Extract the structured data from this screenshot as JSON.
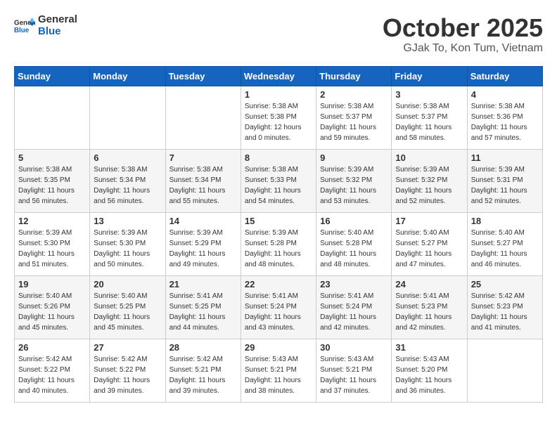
{
  "header": {
    "logo_general": "General",
    "logo_blue": "Blue",
    "month_title": "October 2025",
    "location": "GJak To, Kon Tum, Vietnam"
  },
  "days_of_week": [
    "Sunday",
    "Monday",
    "Tuesday",
    "Wednesday",
    "Thursday",
    "Friday",
    "Saturday"
  ],
  "weeks": [
    [
      null,
      null,
      null,
      {
        "day": "1",
        "sunrise": "Sunrise: 5:38 AM",
        "sunset": "Sunset: 5:38 PM",
        "daylight": "Daylight: 12 hours and 0 minutes."
      },
      {
        "day": "2",
        "sunrise": "Sunrise: 5:38 AM",
        "sunset": "Sunset: 5:37 PM",
        "daylight": "Daylight: 11 hours and 59 minutes."
      },
      {
        "day": "3",
        "sunrise": "Sunrise: 5:38 AM",
        "sunset": "Sunset: 5:37 PM",
        "daylight": "Daylight: 11 hours and 58 minutes."
      },
      {
        "day": "4",
        "sunrise": "Sunrise: 5:38 AM",
        "sunset": "Sunset: 5:36 PM",
        "daylight": "Daylight: 11 hours and 57 minutes."
      }
    ],
    [
      {
        "day": "5",
        "sunrise": "Sunrise: 5:38 AM",
        "sunset": "Sunset: 5:35 PM",
        "daylight": "Daylight: 11 hours and 56 minutes."
      },
      {
        "day": "6",
        "sunrise": "Sunrise: 5:38 AM",
        "sunset": "Sunset: 5:34 PM",
        "daylight": "Daylight: 11 hours and 56 minutes."
      },
      {
        "day": "7",
        "sunrise": "Sunrise: 5:38 AM",
        "sunset": "Sunset: 5:34 PM",
        "daylight": "Daylight: 11 hours and 55 minutes."
      },
      {
        "day": "8",
        "sunrise": "Sunrise: 5:38 AM",
        "sunset": "Sunset: 5:33 PM",
        "daylight": "Daylight: 11 hours and 54 minutes."
      },
      {
        "day": "9",
        "sunrise": "Sunrise: 5:39 AM",
        "sunset": "Sunset: 5:32 PM",
        "daylight": "Daylight: 11 hours and 53 minutes."
      },
      {
        "day": "10",
        "sunrise": "Sunrise: 5:39 AM",
        "sunset": "Sunset: 5:32 PM",
        "daylight": "Daylight: 11 hours and 52 minutes."
      },
      {
        "day": "11",
        "sunrise": "Sunrise: 5:39 AM",
        "sunset": "Sunset: 5:31 PM",
        "daylight": "Daylight: 11 hours and 52 minutes."
      }
    ],
    [
      {
        "day": "12",
        "sunrise": "Sunrise: 5:39 AM",
        "sunset": "Sunset: 5:30 PM",
        "daylight": "Daylight: 11 hours and 51 minutes."
      },
      {
        "day": "13",
        "sunrise": "Sunrise: 5:39 AM",
        "sunset": "Sunset: 5:30 PM",
        "daylight": "Daylight: 11 hours and 50 minutes."
      },
      {
        "day": "14",
        "sunrise": "Sunrise: 5:39 AM",
        "sunset": "Sunset: 5:29 PM",
        "daylight": "Daylight: 11 hours and 49 minutes."
      },
      {
        "day": "15",
        "sunrise": "Sunrise: 5:39 AM",
        "sunset": "Sunset: 5:28 PM",
        "daylight": "Daylight: 11 hours and 48 minutes."
      },
      {
        "day": "16",
        "sunrise": "Sunrise: 5:40 AM",
        "sunset": "Sunset: 5:28 PM",
        "daylight": "Daylight: 11 hours and 48 minutes."
      },
      {
        "day": "17",
        "sunrise": "Sunrise: 5:40 AM",
        "sunset": "Sunset: 5:27 PM",
        "daylight": "Daylight: 11 hours and 47 minutes."
      },
      {
        "day": "18",
        "sunrise": "Sunrise: 5:40 AM",
        "sunset": "Sunset: 5:27 PM",
        "daylight": "Daylight: 11 hours and 46 minutes."
      }
    ],
    [
      {
        "day": "19",
        "sunrise": "Sunrise: 5:40 AM",
        "sunset": "Sunset: 5:26 PM",
        "daylight": "Daylight: 11 hours and 45 minutes."
      },
      {
        "day": "20",
        "sunrise": "Sunrise: 5:40 AM",
        "sunset": "Sunset: 5:25 PM",
        "daylight": "Daylight: 11 hours and 45 minutes."
      },
      {
        "day": "21",
        "sunrise": "Sunrise: 5:41 AM",
        "sunset": "Sunset: 5:25 PM",
        "daylight": "Daylight: 11 hours and 44 minutes."
      },
      {
        "day": "22",
        "sunrise": "Sunrise: 5:41 AM",
        "sunset": "Sunset: 5:24 PM",
        "daylight": "Daylight: 11 hours and 43 minutes."
      },
      {
        "day": "23",
        "sunrise": "Sunrise: 5:41 AM",
        "sunset": "Sunset: 5:24 PM",
        "daylight": "Daylight: 11 hours and 42 minutes."
      },
      {
        "day": "24",
        "sunrise": "Sunrise: 5:41 AM",
        "sunset": "Sunset: 5:23 PM",
        "daylight": "Daylight: 11 hours and 42 minutes."
      },
      {
        "day": "25",
        "sunrise": "Sunrise: 5:42 AM",
        "sunset": "Sunset: 5:23 PM",
        "daylight": "Daylight: 11 hours and 41 minutes."
      }
    ],
    [
      {
        "day": "26",
        "sunrise": "Sunrise: 5:42 AM",
        "sunset": "Sunset: 5:22 PM",
        "daylight": "Daylight: 11 hours and 40 minutes."
      },
      {
        "day": "27",
        "sunrise": "Sunrise: 5:42 AM",
        "sunset": "Sunset: 5:22 PM",
        "daylight": "Daylight: 11 hours and 39 minutes."
      },
      {
        "day": "28",
        "sunrise": "Sunrise: 5:42 AM",
        "sunset": "Sunset: 5:21 PM",
        "daylight": "Daylight: 11 hours and 39 minutes."
      },
      {
        "day": "29",
        "sunrise": "Sunrise: 5:43 AM",
        "sunset": "Sunset: 5:21 PM",
        "daylight": "Daylight: 11 hours and 38 minutes."
      },
      {
        "day": "30",
        "sunrise": "Sunrise: 5:43 AM",
        "sunset": "Sunset: 5:21 PM",
        "daylight": "Daylight: 11 hours and 37 minutes."
      },
      {
        "day": "31",
        "sunrise": "Sunrise: 5:43 AM",
        "sunset": "Sunset: 5:20 PM",
        "daylight": "Daylight: 11 hours and 36 minutes."
      },
      null
    ]
  ]
}
